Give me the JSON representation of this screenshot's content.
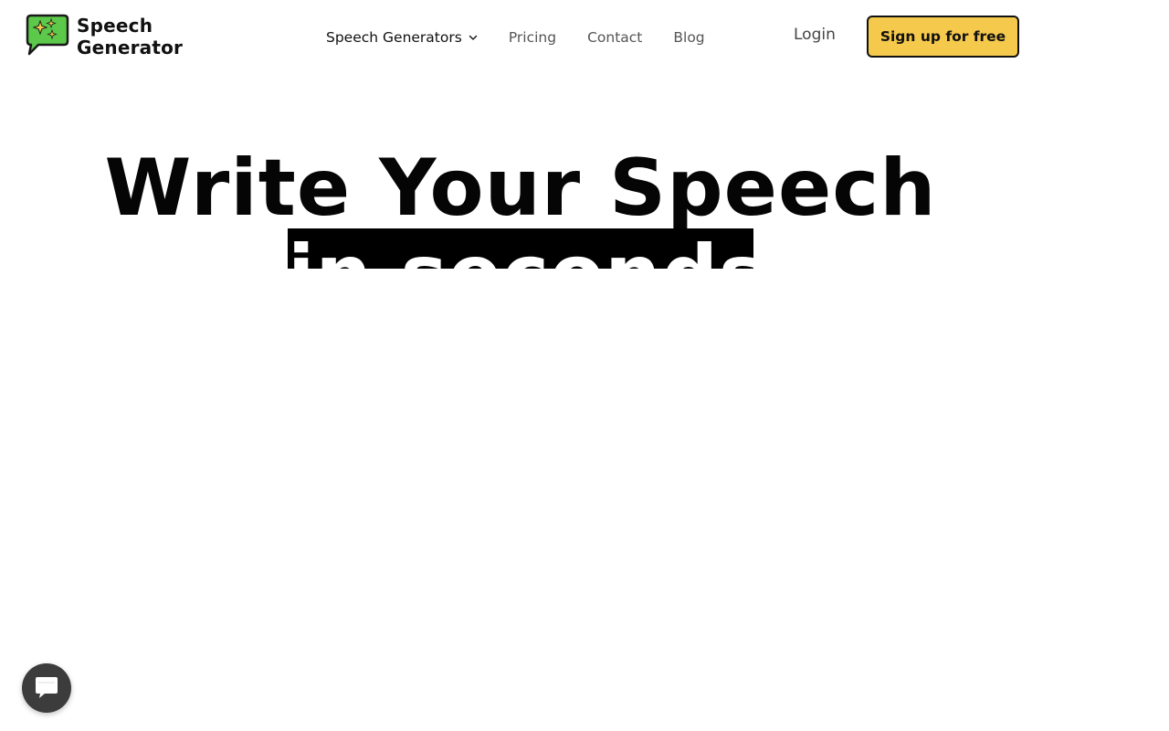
{
  "header": {
    "logo": {
      "line1": "Speech",
      "line2": "Generator",
      "icon": "speech-bubble-sparkle-icon"
    },
    "nav": [
      {
        "label": "Speech Generators",
        "has_dropdown": true
      },
      {
        "label": "Pricing"
      },
      {
        "label": "Contact"
      },
      {
        "label": "Blog"
      }
    ],
    "login_label": "Login",
    "signup_label": "Sign up for free"
  },
  "hero": {
    "title": "Write Your Speech",
    "highlight": "in seconds"
  },
  "chat_widget": {
    "icon": "chat-bubble-icon"
  },
  "colors": {
    "accent": "#f5c94c",
    "logo_bubble": "#5cc94a",
    "text": "#050505",
    "chat_widget": "#3c3c3c"
  }
}
